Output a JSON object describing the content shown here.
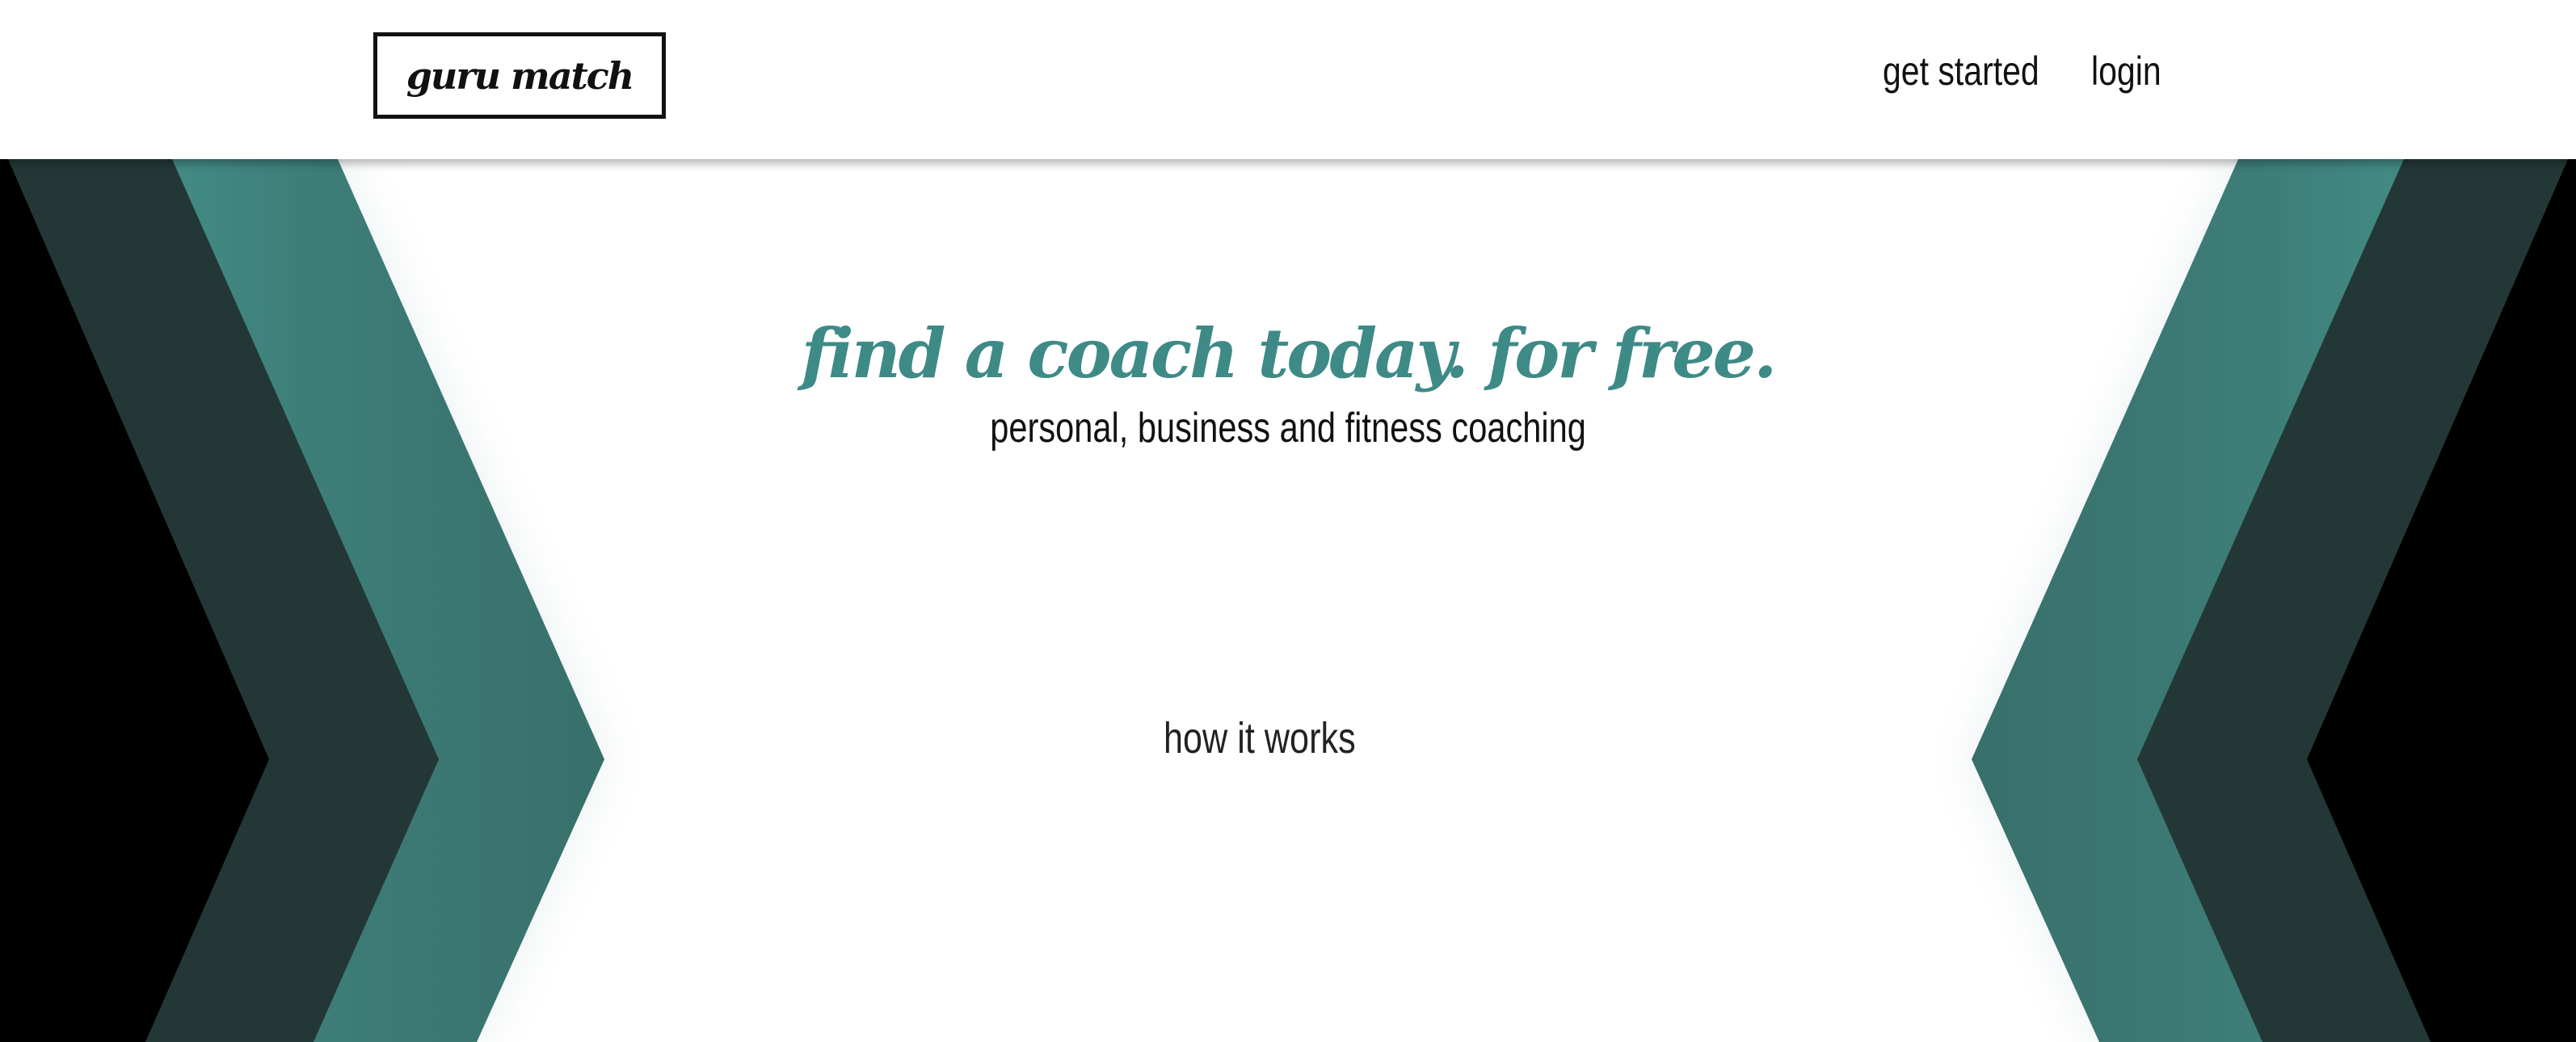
{
  "header": {
    "logo_text": "guru match",
    "nav": {
      "get_started": "get started",
      "login": "login"
    }
  },
  "hero": {
    "title": "find a coach today. for free.",
    "subtitle": "personal, business and fitness coaching",
    "how_it_works": "how it works"
  },
  "colors": {
    "accent_teal": "#3e8a87",
    "dark_green": "#233836",
    "black": "#000000",
    "background": "#ffffff"
  }
}
